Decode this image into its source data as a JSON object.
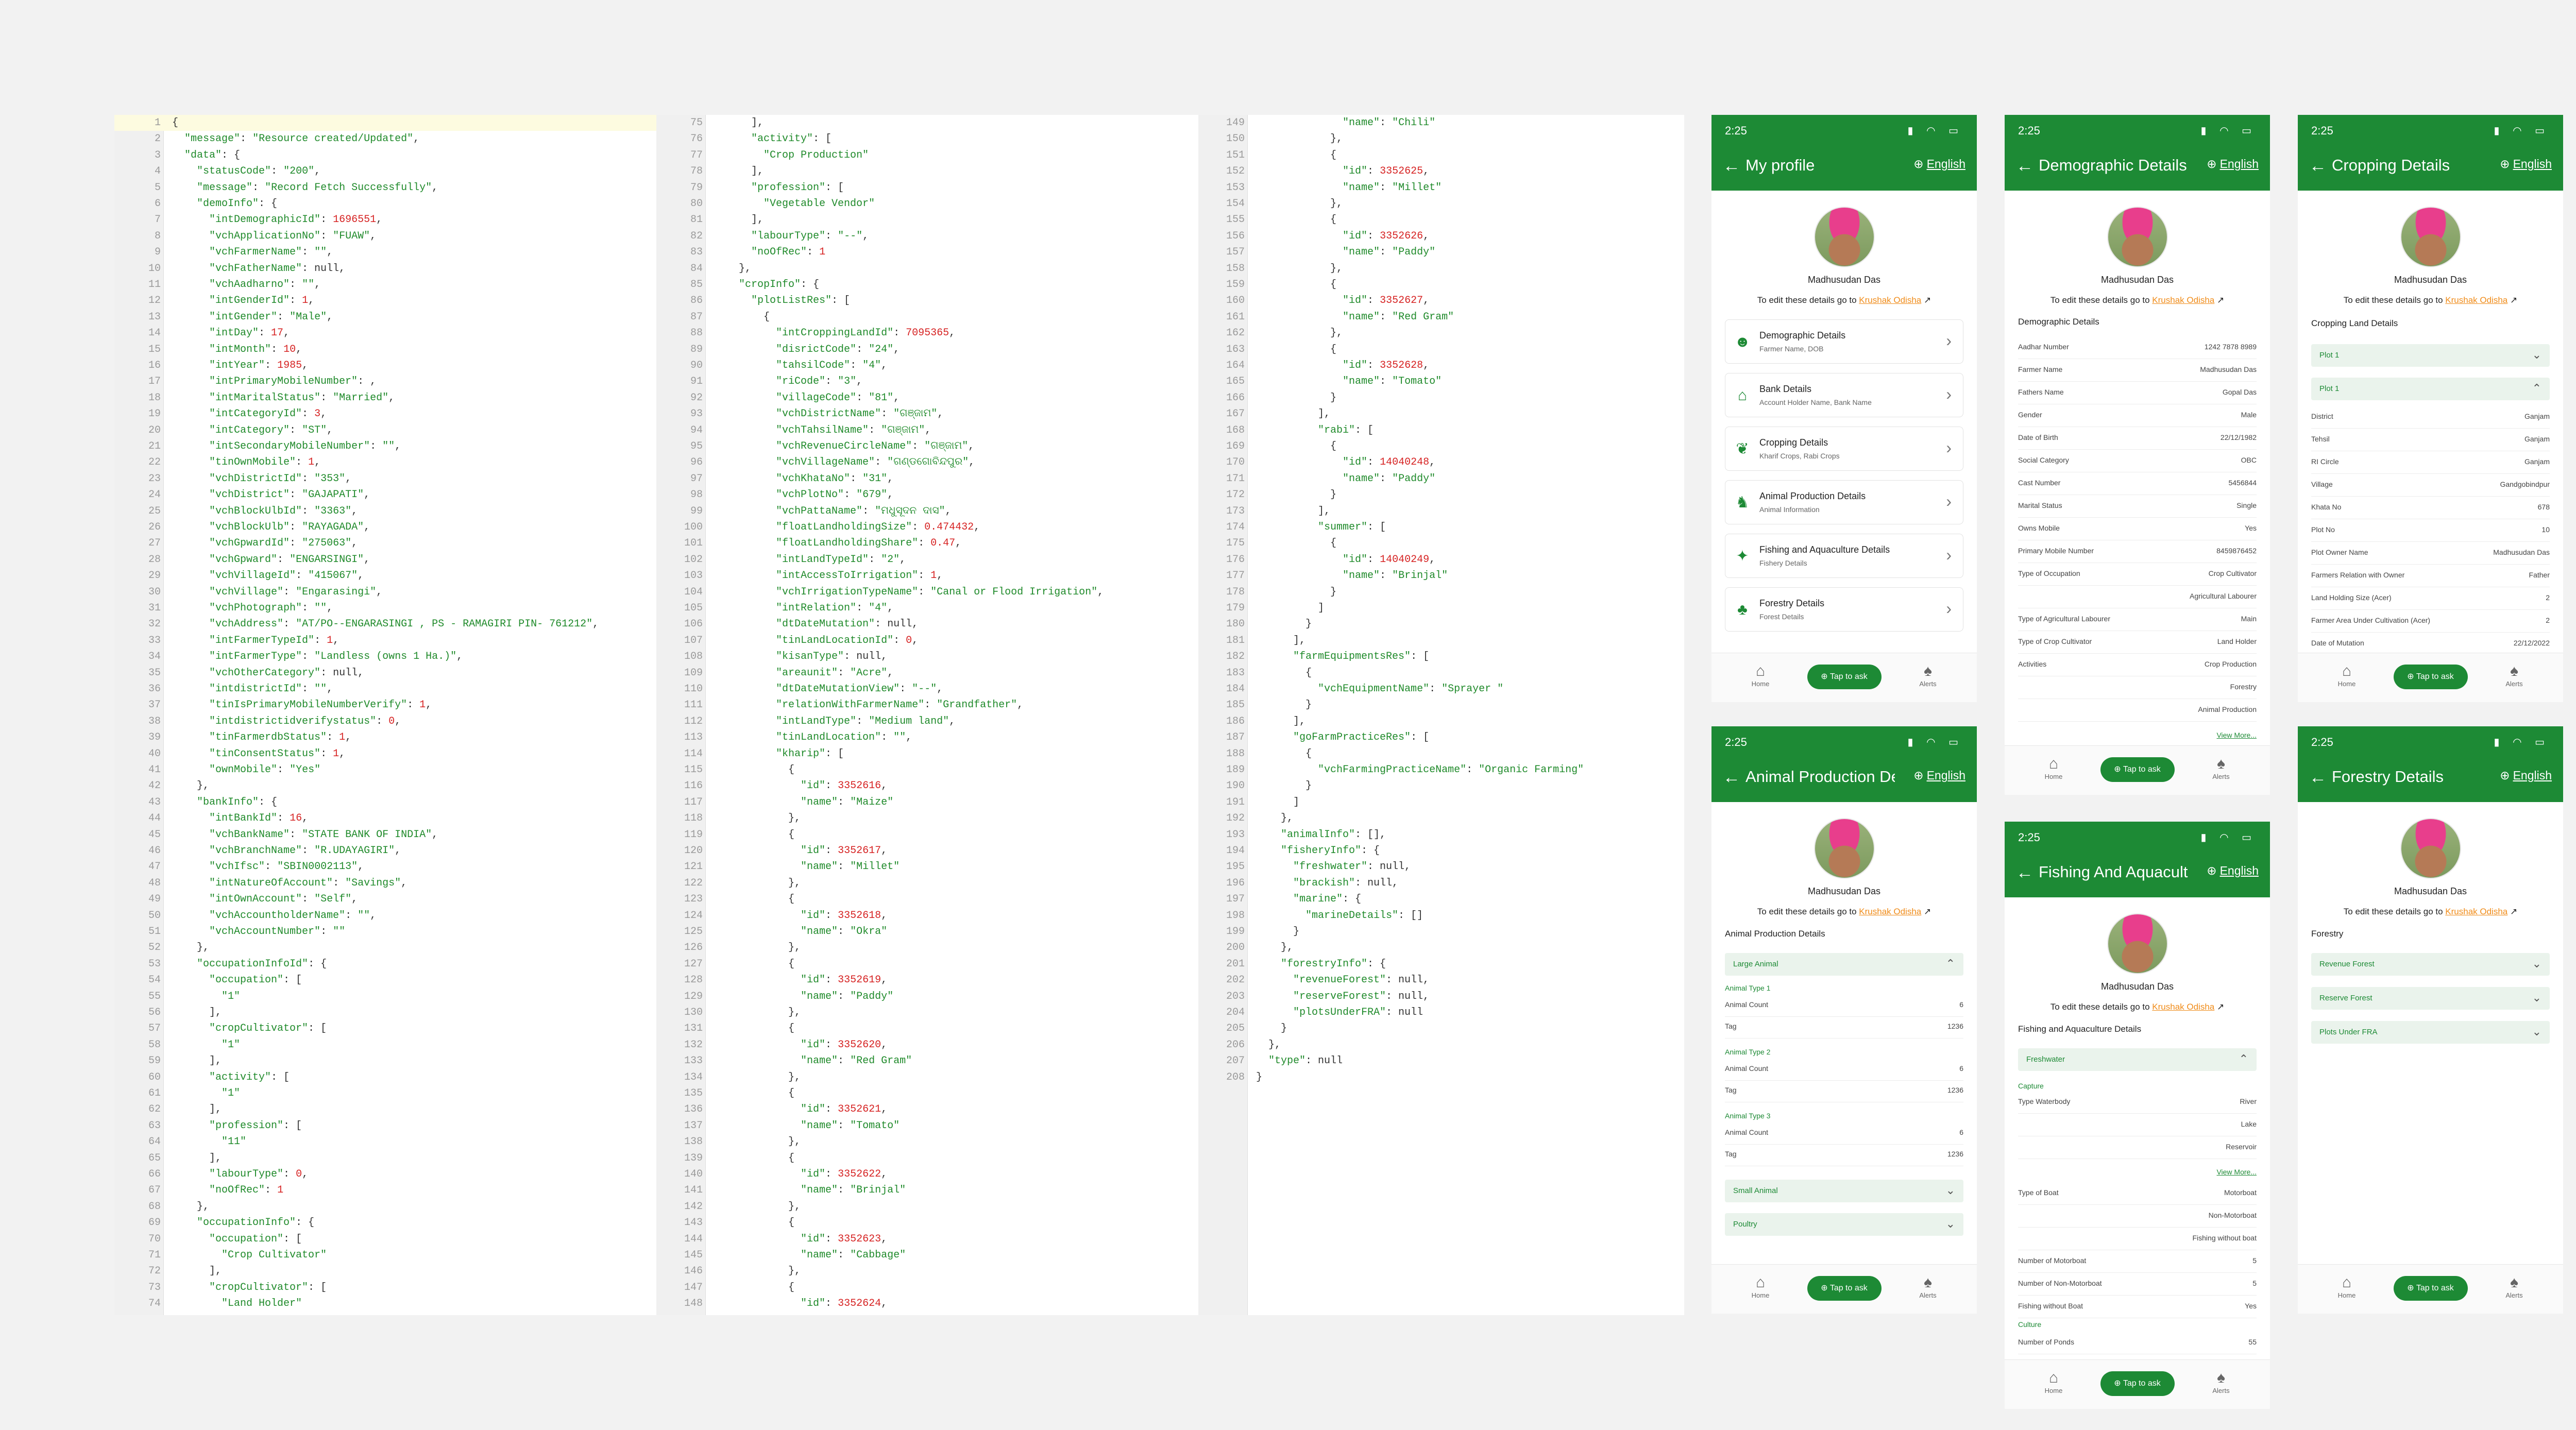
{
  "editor": {
    "col1": [
      [
        "1",
        "{"
      ],
      [
        "2",
        "  \"message\": \"Resource created/Updated\","
      ],
      [
        "3",
        "  \"data\": {"
      ],
      [
        "4",
        "    \"statusCode\": \"200\","
      ],
      [
        "5",
        "    \"message\": \"Record Fetch Successfully\","
      ],
      [
        "6",
        "    \"demoInfo\": {"
      ],
      [
        "7",
        "      \"intDemographicId\": 1696551,"
      ],
      [
        "8",
        "      \"vchApplicationNo\": \"FUAW\","
      ],
      [
        "9",
        "      \"vchFarmerName\": \"\","
      ],
      [
        "10",
        "      \"vchFatherName\": null,"
      ],
      [
        "11",
        "      \"vchAadharno\": \"\","
      ],
      [
        "12",
        "      \"intGenderId\": 1,"
      ],
      [
        "13",
        "      \"intGender\": \"Male\","
      ],
      [
        "14",
        "      \"intDay\": 17,"
      ],
      [
        "15",
        "      \"intMonth\": 10,"
      ],
      [
        "16",
        "      \"intYear\": 1985,"
      ],
      [
        "17",
        "      \"intPrimaryMobileNumber\": ,"
      ],
      [
        "18",
        "      \"intMaritalStatus\": \"Married\","
      ],
      [
        "19",
        "      \"intCategoryId\": 3,"
      ],
      [
        "20",
        "      \"intCategory\": \"ST\","
      ],
      [
        "21",
        "      \"intSecondaryMobileNumber\": \"\","
      ],
      [
        "22",
        "      \"tinOwnMobile\": 1,"
      ],
      [
        "23",
        "      \"vchDistrictId\": \"353\","
      ],
      [
        "24",
        "      \"vchDistrict\": \"GAJAPATI\","
      ],
      [
        "25",
        "      \"vchBlockUlbId\": \"3363\","
      ],
      [
        "26",
        "      \"vchBlockUlb\": \"RAYAGADA\","
      ],
      [
        "27",
        "      \"vchGpwardId\": \"275063\","
      ],
      [
        "28",
        "      \"vchGpward\": \"ENGARSINGI\","
      ],
      [
        "29",
        "      \"vchVillageId\": \"415067\","
      ],
      [
        "30",
        "      \"vchVillage\": \"Engarasingi\","
      ],
      [
        "31",
        "      \"vchPhotograph\": \"\","
      ],
      [
        "32",
        "      \"vchAddress\": \"AT/PO--ENGARASINGI , PS - RAMAGIRI PIN- 761212\","
      ],
      [
        "33",
        "      \"intFarmerTypeId\": 1,"
      ],
      [
        "34",
        "      \"intFarmerType\": \"Landless (owns 1 Ha.)\","
      ],
      [
        "35",
        "      \"vchOtherCategory\": null,"
      ],
      [
        "36",
        "      \"intdistrictId\": \"\","
      ],
      [
        "37",
        "      \"tinIsPrimaryMobileNumberVerify\": 1,"
      ],
      [
        "38",
        "      \"intdistrictidverifystatus\": 0,"
      ],
      [
        "39",
        "      \"tinFarmerdbStatus\": 1,"
      ],
      [
        "40",
        "      \"tinConsentStatus\": 1,"
      ],
      [
        "41",
        "      \"ownMobile\": \"Yes\""
      ],
      [
        "42",
        "    },"
      ],
      [
        "43",
        "    \"bankInfo\": {"
      ],
      [
        "44",
        "      \"intBankId\": 16,"
      ],
      [
        "45",
        "      \"vchBankName\": \"STATE BANK OF INDIA\","
      ],
      [
        "46",
        "      \"vchBranchName\": \"R.UDAYAGIRI\","
      ],
      [
        "47",
        "      \"vchIfsc\": \"SBIN0002113\","
      ],
      [
        "48",
        "      \"intNatureOfAccount\": \"Savings\","
      ],
      [
        "49",
        "      \"intOwnAccount\": \"Self\","
      ],
      [
        "50",
        "      \"vchAccountholderName\": \"\","
      ],
      [
        "51",
        "      \"vchAccountNumber\": \"\""
      ],
      [
        "52",
        "    },"
      ],
      [
        "53",
        "    \"occupationInfoId\": {"
      ],
      [
        "54",
        "      \"occupation\": ["
      ],
      [
        "55",
        "        \"1\""
      ],
      [
        "56",
        "      ],"
      ],
      [
        "57",
        "      \"cropCultivator\": ["
      ],
      [
        "58",
        "        \"1\""
      ],
      [
        "59",
        "      ],"
      ],
      [
        "60",
        "      \"activity\": ["
      ],
      [
        "61",
        "        \"1\""
      ],
      [
        "62",
        "      ],"
      ],
      [
        "63",
        "      \"profession\": ["
      ],
      [
        "64",
        "        \"11\""
      ],
      [
        "65",
        "      ],"
      ],
      [
        "66",
        "      \"labourType\": 0,"
      ],
      [
        "67",
        "      \"noOfRec\": 1"
      ],
      [
        "68",
        "    },"
      ],
      [
        "69",
        "    \"occupationInfo\": {"
      ],
      [
        "70",
        "      \"occupation\": ["
      ],
      [
        "71",
        "        \"Crop Cultivator\""
      ],
      [
        "72",
        "      ],"
      ],
      [
        "73",
        "      \"cropCultivator\": ["
      ],
      [
        "74",
        "        \"Land Holder\""
      ]
    ],
    "col2": [
      [
        "75",
        "      ],"
      ],
      [
        "76",
        "      \"activity\": ["
      ],
      [
        "77",
        "        \"Crop Production\""
      ],
      [
        "78",
        "      ],"
      ],
      [
        "79",
        "      \"profession\": ["
      ],
      [
        "80",
        "        \"Vegetable Vendor\""
      ],
      [
        "81",
        "      ],"
      ],
      [
        "82",
        "      \"labourType\": \"--\","
      ],
      [
        "83",
        "      \"noOfRec\": 1"
      ],
      [
        "84",
        "    },"
      ],
      [
        "85",
        "    \"cropInfo\": {"
      ],
      [
        "86",
        "      \"plotListRes\": ["
      ],
      [
        "87",
        "        {"
      ],
      [
        "88",
        "          \"intCroppingLandId\": 7095365,"
      ],
      [
        "89",
        "          \"disrictCode\": \"24\","
      ],
      [
        "90",
        "          \"tahsilCode\": \"4\","
      ],
      [
        "91",
        "          \"riCode\": \"3\","
      ],
      [
        "92",
        "          \"villageCode\": \"81\","
      ],
      [
        "93",
        "          \"vchDistrictName\": \"ଗଞ୍ଜାମ\","
      ],
      [
        "94",
        "          \"vchTahsilName\": \"ଗଞ୍ଜାମ\","
      ],
      [
        "95",
        "          \"vchRevenueCircleName\": \"ଗଞ୍ଜାମ\","
      ],
      [
        "96",
        "          \"vchVillageName\": \"ଗଣ୍ଡଗୋବିନ୍ଦପୁର\","
      ],
      [
        "97",
        "          \"vchKhataNo\": \"31\","
      ],
      [
        "98",
        "          \"vchPlotNo\": \"679\","
      ],
      [
        "99",
        "          \"vchPattaName\": \"ମଧୁସୂଦନ ଦାସ\","
      ],
      [
        "100",
        "          \"floatLandholdingSize\": 0.474432,"
      ],
      [
        "101",
        "          \"floatLandholdingShare\": 0.47,"
      ],
      [
        "102",
        "          \"intLandTypeId\": \"2\","
      ],
      [
        "103",
        "          \"intAccessToIrrigation\": 1,"
      ],
      [
        "104",
        "          \"vchIrrigationTypeName\": \"Canal or Flood Irrigation\","
      ],
      [
        "105",
        "          \"intRelation\": \"4\","
      ],
      [
        "106",
        "          \"dtDateMutation\": null,"
      ],
      [
        "107",
        "          \"tinLandLocationId\": 0,"
      ],
      [
        "108",
        "          \"kisanType\": null,"
      ],
      [
        "109",
        "          \"areaunit\": \"Acre\","
      ],
      [
        "110",
        "          \"dtDateMutationView\": \"--\","
      ],
      [
        "111",
        "          \"relationWithFarmerName\": \"Grandfather\","
      ],
      [
        "112",
        "          \"intLandType\": \"Medium land\","
      ],
      [
        "113",
        "          \"tinLandLocation\": \"\","
      ],
      [
        "114",
        "          \"kharip\": ["
      ],
      [
        "115",
        "            {"
      ],
      [
        "116",
        "              \"id\": 3352616,"
      ],
      [
        "117",
        "              \"name\": \"Maize\""
      ],
      [
        "118",
        "            },"
      ],
      [
        "119",
        "            {"
      ],
      [
        "120",
        "              \"id\": 3352617,"
      ],
      [
        "121",
        "              \"name\": \"Millet\""
      ],
      [
        "122",
        "            },"
      ],
      [
        "123",
        "            {"
      ],
      [
        "124",
        "              \"id\": 3352618,"
      ],
      [
        "125",
        "              \"name\": \"Okra\""
      ],
      [
        "126",
        "            },"
      ],
      [
        "127",
        "            {"
      ],
      [
        "128",
        "              \"id\": 3352619,"
      ],
      [
        "129",
        "              \"name\": \"Paddy\""
      ],
      [
        "130",
        "            },"
      ],
      [
        "131",
        "            {"
      ],
      [
        "132",
        "              \"id\": 3352620,"
      ],
      [
        "133",
        "              \"name\": \"Red Gram\""
      ],
      [
        "134",
        "            },"
      ],
      [
        "135",
        "            {"
      ],
      [
        "136",
        "              \"id\": 3352621,"
      ],
      [
        "137",
        "              \"name\": \"Tomato\""
      ],
      [
        "138",
        "            },"
      ],
      [
        "139",
        "            {"
      ],
      [
        "140",
        "              \"id\": 3352622,"
      ],
      [
        "141",
        "              \"name\": \"Brinjal\""
      ],
      [
        "142",
        "            },"
      ],
      [
        "143",
        "            {"
      ],
      [
        "144",
        "              \"id\": 3352623,"
      ],
      [
        "145",
        "              \"name\": \"Cabbage\""
      ],
      [
        "146",
        "            },"
      ],
      [
        "147",
        "            {"
      ],
      [
        "148",
        "              \"id\": 3352624,"
      ]
    ],
    "col3": [
      [
        "149",
        "              \"name\": \"Chili\""
      ],
      [
        "150",
        "            },"
      ],
      [
        "151",
        "            {"
      ],
      [
        "152",
        "              \"id\": 3352625,"
      ],
      [
        "153",
        "              \"name\": \"Millet\""
      ],
      [
        "154",
        "            },"
      ],
      [
        "155",
        "            {"
      ],
      [
        "156",
        "              \"id\": 3352626,"
      ],
      [
        "157",
        "              \"name\": \"Paddy\""
      ],
      [
        "158",
        "            },"
      ],
      [
        "159",
        "            {"
      ],
      [
        "160",
        "              \"id\": 3352627,"
      ],
      [
        "161",
        "              \"name\": \"Red Gram\""
      ],
      [
        "162",
        "            },"
      ],
      [
        "163",
        "            {"
      ],
      [
        "164",
        "              \"id\": 3352628,"
      ],
      [
        "165",
        "              \"name\": \"Tomato\""
      ],
      [
        "166",
        "            }"
      ],
      [
        "167",
        "          ],"
      ],
      [
        "168",
        "          \"rabi\": ["
      ],
      [
        "169",
        "            {"
      ],
      [
        "170",
        "              \"id\": 14040248,"
      ],
      [
        "171",
        "              \"name\": \"Paddy\""
      ],
      [
        "172",
        "            }"
      ],
      [
        "173",
        "          ],"
      ],
      [
        "174",
        "          \"summer\": ["
      ],
      [
        "175",
        "            {"
      ],
      [
        "176",
        "              \"id\": 14040249,"
      ],
      [
        "177",
        "              \"name\": \"Brinjal\""
      ],
      [
        "178",
        "            }"
      ],
      [
        "179",
        "          ]"
      ],
      [
        "180",
        "        }"
      ],
      [
        "181",
        "      ],"
      ],
      [
        "182",
        "      \"farmEquipmentsRes\": ["
      ],
      [
        "183",
        "        {"
      ],
      [
        "184",
        "          \"vchEquipmentName\": \"Sprayer \""
      ],
      [
        "185",
        "        }"
      ],
      [
        "186",
        "      ],"
      ],
      [
        "187",
        "      \"goFarmPracticeRes\": ["
      ],
      [
        "188",
        "        {"
      ],
      [
        "189",
        "          \"vchFarmingPracticeName\": \"Organic Farming\""
      ],
      [
        "190",
        "        }"
      ],
      [
        "191",
        "      ]"
      ],
      [
        "192",
        "    },"
      ],
      [
        "193",
        "    \"animalInfo\": [],"
      ],
      [
        "194",
        "    \"fisheryInfo\": {"
      ],
      [
        "195",
        "      \"freshwater\": null,"
      ],
      [
        "196",
        "      \"brackish\": null,"
      ],
      [
        "197",
        "      \"marine\": {"
      ],
      [
        "198",
        "        \"marineDetails\": []"
      ],
      [
        "199",
        "      }"
      ],
      [
        "200",
        "    },"
      ],
      [
        "201",
        "    \"forestryInfo\": {"
      ],
      [
        "202",
        "      \"revenueForest\": null,"
      ],
      [
        "203",
        "      \"reserveForest\": null,"
      ],
      [
        "204",
        "      \"plotsUnderFRA\": null"
      ],
      [
        "205",
        "    }"
      ],
      [
        "206",
        "  },"
      ],
      [
        "207",
        "  \"type\": null"
      ],
      [
        "208",
        "}"
      ]
    ]
  },
  "common": {
    "time": "2:25",
    "lang": "English",
    "name": "Madhusudan Das",
    "edit_prefix": "To edit these details go to",
    "edit_link": "Krushak Odisha",
    "home": "Home",
    "tap": "Tap to ask",
    "alerts": "Alerts"
  },
  "profile": {
    "title": "My profile",
    "cards": [
      {
        "t": "Demographic Details",
        "s": "Farmer Name, DOB",
        "icon": "person-icon"
      },
      {
        "t": "Bank Details",
        "s": "Account Holder Name, Bank Name",
        "icon": "bank-icon"
      },
      {
        "t": "Cropping Details",
        "s": "Kharif Crops, Rabi Crops",
        "icon": "crop-icon"
      },
      {
        "t": "Animal Production Details",
        "s": "Animal Information",
        "icon": "animal-icon"
      },
      {
        "t": "Fishing and Aquaculture Details",
        "s": "Fishery Details",
        "icon": "fish-icon"
      },
      {
        "t": "Forestry Details",
        "s": "Forest Details",
        "icon": "tree-icon"
      }
    ]
  },
  "demographic": {
    "title": "Demographic Details",
    "section": "Demographic Details",
    "rows": [
      [
        "Aadhar Number",
        "1242 7878 8989"
      ],
      [
        "Farmer Name",
        "Madhusudan Das"
      ],
      [
        "Fathers Name",
        "Gopal Das"
      ],
      [
        "Gender",
        "Male"
      ],
      [
        "Date of Birth",
        "22/12/1982"
      ],
      [
        "Social Category",
        "OBC"
      ],
      [
        "Cast Number",
        "5456844"
      ],
      [
        "Marital Status",
        "Single"
      ],
      [
        "Owns Mobile",
        "Yes"
      ],
      [
        "Primary Mobile Number",
        "8459876452"
      ],
      [
        "Type of Occupation",
        "Crop Cultivator"
      ],
      [
        "",
        "Agricultural Labourer"
      ],
      [
        "Type of Agricultural Labourer",
        "Main"
      ],
      [
        "Type of Crop Cultivator",
        "Land Holder"
      ],
      [
        "Activities",
        "Crop Production"
      ],
      [
        "",
        "Forestry"
      ],
      [
        "",
        "Animal Production"
      ]
    ],
    "view_more": "View More..."
  },
  "cropping": {
    "title": "Cropping Details",
    "section": "Cropping Land Details",
    "plot1": "Plot 1",
    "plot1b": "Plot 1",
    "rows": [
      [
        "District",
        "Ganjam"
      ],
      [
        "Tehsil",
        "Ganjam"
      ],
      [
        "RI Circle",
        "Ganjam"
      ],
      [
        "Village",
        "Gandgobindpur"
      ],
      [
        "Khata No",
        "678"
      ],
      [
        "Plot No",
        "10"
      ],
      [
        "Plot Owner Name",
        "Madhusudan Das"
      ],
      [
        "Farmers Relation with Owner",
        "Father"
      ],
      [
        "Land Holding Size (Acer)",
        "2"
      ],
      [
        "Farmer Area Under Cultivation (Acer)",
        "2"
      ],
      [
        "Date of Mutation",
        "22/12/2022"
      ]
    ]
  },
  "animal": {
    "title": "Animal Production Details",
    "section": "Animal Production Details",
    "large": "Large Animal",
    "types": [
      {
        "label": "Animal Type 1",
        "count": "6",
        "tag": "1236"
      },
      {
        "label": "Animal Type 2",
        "count": "6",
        "tag": "1236"
      },
      {
        "label": "Animal Type 3",
        "count": "6",
        "tag": "1236"
      }
    ],
    "count_label": "Animal Count",
    "tag_label": "Tag",
    "small": "Small Animal",
    "poultry": "Poultry"
  },
  "fishing": {
    "title": "Fishing And Aquaculture Details",
    "section": "Fishing and Aquaculture Details",
    "freshwater": "Freshwater",
    "capture": "Capture",
    "rows": [
      [
        "Type Waterbody",
        "River"
      ],
      [
        "",
        "Lake"
      ],
      [
        "",
        "Reservoir"
      ]
    ],
    "view_more": "View More...",
    "rows2": [
      [
        "Type of Boat",
        "Motorboat"
      ],
      [
        "",
        "Non-Motorboat"
      ],
      [
        "",
        "Fishing without boat"
      ],
      [
        "Number of Motorboat",
        "5"
      ],
      [
        "Number of Non-Motorboat",
        "5"
      ],
      [
        "Fishing without Boat",
        "Yes"
      ]
    ],
    "culture": "Culture",
    "rows3": [
      [
        "Number of Ponds",
        "55"
      ]
    ]
  },
  "forestry": {
    "title": "Forestry Details",
    "section": "Forestry",
    "items": [
      "Revenue Forest",
      "Reserve Forest",
      "Plots Under FRA"
    ]
  }
}
